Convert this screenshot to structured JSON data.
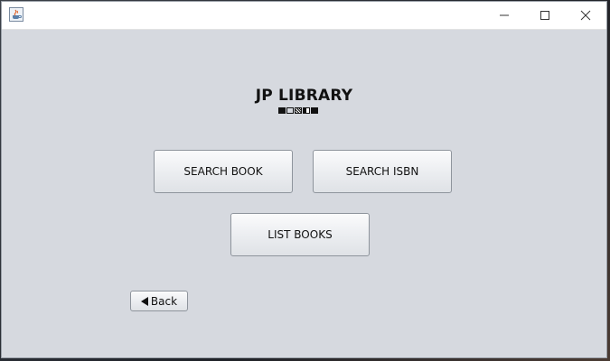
{
  "window": {
    "icon": "java-cup-icon",
    "controls": {
      "minimize": "minimize-icon",
      "maximize": "maximize-icon",
      "close": "close-icon"
    }
  },
  "main": {
    "title": "JP LIBRARY",
    "buttons": {
      "search_book": "SEARCH BOOK",
      "search_isbn": "SEARCH ISBN",
      "list_books": "LIST BOOKS",
      "back": "Back"
    }
  },
  "colors": {
    "window_bg": "#d6d9df",
    "titlebar_bg": "#ffffff"
  }
}
